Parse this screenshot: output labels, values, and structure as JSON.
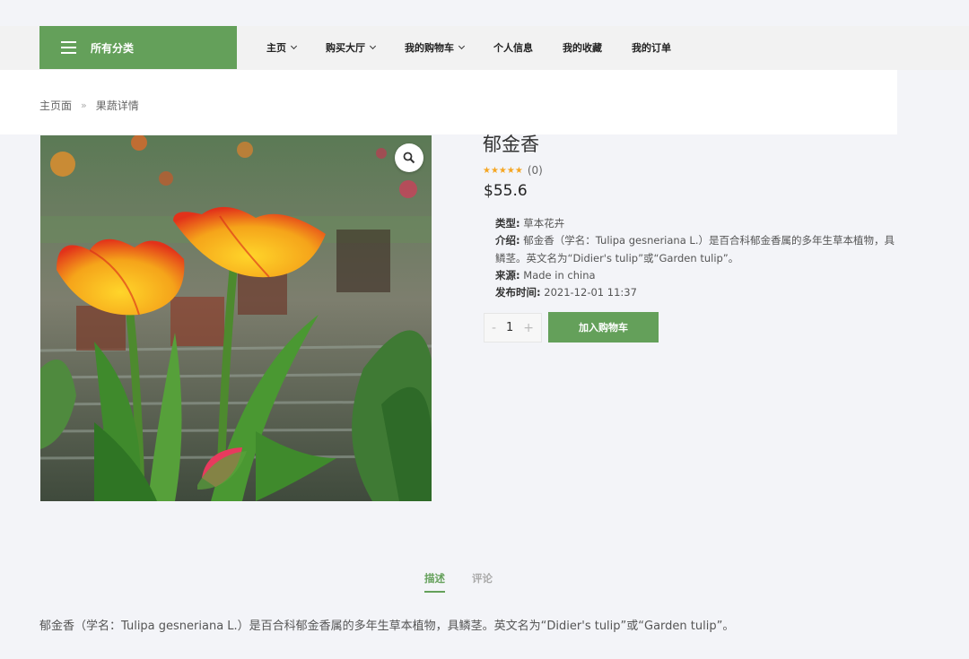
{
  "header": {
    "category_button": "所有分类",
    "nav": [
      {
        "label": "主页",
        "dropdown": true
      },
      {
        "label": "购买大厅",
        "dropdown": true
      },
      {
        "label": "我的购物车",
        "dropdown": true
      },
      {
        "label": "个人信息",
        "dropdown": false
      },
      {
        "label": "我的收藏",
        "dropdown": false
      },
      {
        "label": "我的订单",
        "dropdown": false
      }
    ]
  },
  "breadcrumb": {
    "home": "主页面",
    "separator": "»",
    "current": "果蔬详情"
  },
  "product": {
    "name": "郁金香",
    "rating_stars": 5,
    "review_count": "(0)",
    "price": "$55.6",
    "details": [
      {
        "label": "类型:",
        "value": "草本花卉"
      },
      {
        "label": "介绍:",
        "value": "郁金香（学名：Tulipa gesneriana L.）是百合科郁金香属的多年生草本植物，具鳞茎。英文名为“Didier's tulip”或“Garden tulip”。"
      },
      {
        "label": "来源:",
        "value": "Made in china"
      },
      {
        "label": "发布时间:",
        "value": "2021-12-01 11:37"
      }
    ],
    "quantity": "1",
    "quantity_minus": "-",
    "quantity_plus": "+",
    "add_to_cart": "加入购物车"
  },
  "tabs": [
    {
      "label": "描述",
      "active": true
    },
    {
      "label": "评论",
      "active": false
    }
  ],
  "description": "郁金香（学名：Tulipa gesneriana L.）是百合科郁金香属的多年生草本植物，具鳞茎。英文名为“Didier's tulip”或“Garden tulip”。",
  "colors": {
    "brand_green": "#64a05a",
    "star": "#f5a623"
  }
}
